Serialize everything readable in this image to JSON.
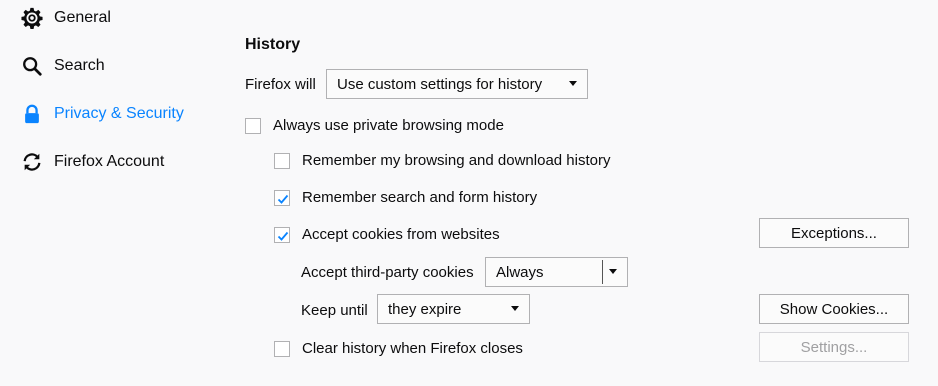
{
  "sidebar": {
    "items": [
      {
        "label": "General",
        "icon": "gear-icon"
      },
      {
        "label": "Search",
        "icon": "search-icon"
      },
      {
        "label": "Privacy & Security",
        "icon": "lock-icon",
        "selected": true
      },
      {
        "label": "Firefox Account",
        "icon": "sync-icon"
      }
    ]
  },
  "history": {
    "heading": "History",
    "firefox_will_label": "Firefox will",
    "firefox_will_value": "Use custom settings for history",
    "private_mode": {
      "label": "Always use private browsing mode",
      "checked": false
    },
    "remember_browsing": {
      "label": "Remember my browsing and download history",
      "checked": false
    },
    "remember_search": {
      "label": "Remember search and form history",
      "checked": true
    },
    "accept_cookies": {
      "label": "Accept cookies from websites",
      "checked": true
    },
    "third_party_label": "Accept third-party cookies",
    "third_party_value": "Always",
    "keep_until_label": "Keep until",
    "keep_until_value": "they expire",
    "clear_history": {
      "label": "Clear history when Firefox closes",
      "checked": false
    },
    "buttons": {
      "exceptions": "Exceptions...",
      "show_cookies": "Show Cookies...",
      "settings": "Settings..."
    }
  },
  "colors": {
    "accent": "#0a84ff",
    "checkmark": "#0a84ff"
  }
}
